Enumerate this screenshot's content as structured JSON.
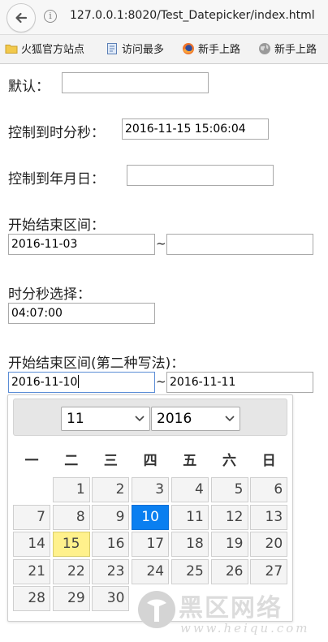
{
  "browser": {
    "url": "127.0.0.1:8020/Test_Datepicker/index.html",
    "bookmarks": [
      {
        "label": "火狐官方站点",
        "icon": "folder-icon"
      },
      {
        "label": "访问最多",
        "icon": "document-icon"
      },
      {
        "label": "新手上路",
        "icon": "firefox-icon"
      },
      {
        "label": "新手上路",
        "icon": "globe-icon"
      }
    ]
  },
  "form": {
    "default_label": "默认：",
    "default_value": "",
    "datetime_label": "控制到时分秒：",
    "datetime_value": "2016-11-15 15:06:04",
    "date_label": "控制到年月日：",
    "date_value": "",
    "range_label": "开始结束区间：",
    "range_start": "2016-11-03",
    "range_separator": "~",
    "range_end": "",
    "time_label": "时分秒选择：",
    "time_value": "04:07:00",
    "range2_label": "开始结束区间(第二种写法)：",
    "range2_start": "2016-11-10",
    "range2_separator": "~",
    "range2_end": "2016-11-11"
  },
  "datepicker": {
    "month": "11",
    "year": "2016",
    "weekdays": [
      "一",
      "二",
      "三",
      "四",
      "五",
      "六",
      "日"
    ],
    "today": 15,
    "selected": 10,
    "first_weekday_index": 1,
    "days_in_month": 30
  },
  "watermark": {
    "text": "黑区网络",
    "url": "www.heiqu.com"
  }
}
